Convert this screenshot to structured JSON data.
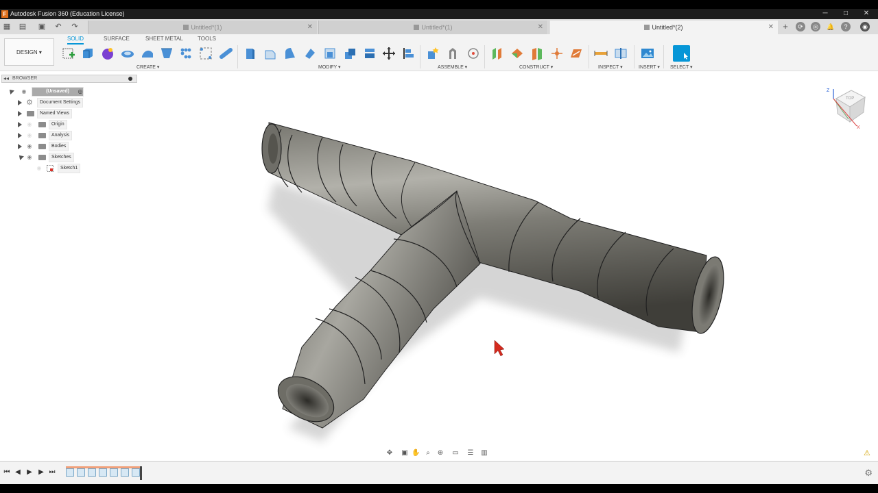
{
  "window": {
    "title": "Autodesk Fusion 360 (Education License)",
    "logo_letter": "F",
    "controls": {
      "minimize": "─",
      "maximize": "□",
      "close": "✕"
    }
  },
  "tabs": [
    {
      "label": "Untitled*(1)",
      "active": false
    },
    {
      "label": "Untitled*(1)",
      "active": false
    },
    {
      "label": "Untitled*(2)",
      "active": true
    }
  ],
  "tab_close_glyph": "✕",
  "add_tab_glyph": "+",
  "toolbar": {
    "workspace": "DESIGN ▾",
    "categories": [
      "SOLID",
      "SURFACE",
      "SHEET METAL",
      "TOOLS"
    ],
    "active_category": "SOLID",
    "groups": [
      "CREATE ▾",
      "MODIFY ▾",
      "ASSEMBLE ▾",
      "CONSTRUCT ▾",
      "INSPECT ▾",
      "INSERT ▾",
      "SELECT ▾"
    ]
  },
  "browser": {
    "header": "BROWSER",
    "collapse_glyph": "◂◂",
    "items": [
      {
        "label": "(Unsaved)",
        "icon": "document-icon",
        "visible": true
      },
      {
        "label": "Document Settings",
        "icon": "gear-icon",
        "visible": null
      },
      {
        "label": "Named Views",
        "icon": "folder-icon",
        "visible": null
      },
      {
        "label": "Origin",
        "icon": "folder-icon",
        "visible": false
      },
      {
        "label": "Analysis",
        "icon": "folder-icon",
        "visible": false
      },
      {
        "label": "Bodies",
        "icon": "folder-icon",
        "visible": true
      },
      {
        "label": "Sketches",
        "icon": "folder-icon",
        "visible": true
      },
      {
        "label": "Sketch1",
        "icon": "sketch-icon",
        "visible": false
      }
    ]
  },
  "viewcube": {
    "face": "TOP",
    "axis_z": "Z",
    "axis_x": "X"
  },
  "colors": {
    "accent": "#0696d7",
    "create": "#7a3fd1",
    "body": "#6b6a63"
  },
  "timeline": {
    "controls": [
      "⏮",
      "◀",
      "▶",
      "▶",
      "⏭"
    ]
  }
}
